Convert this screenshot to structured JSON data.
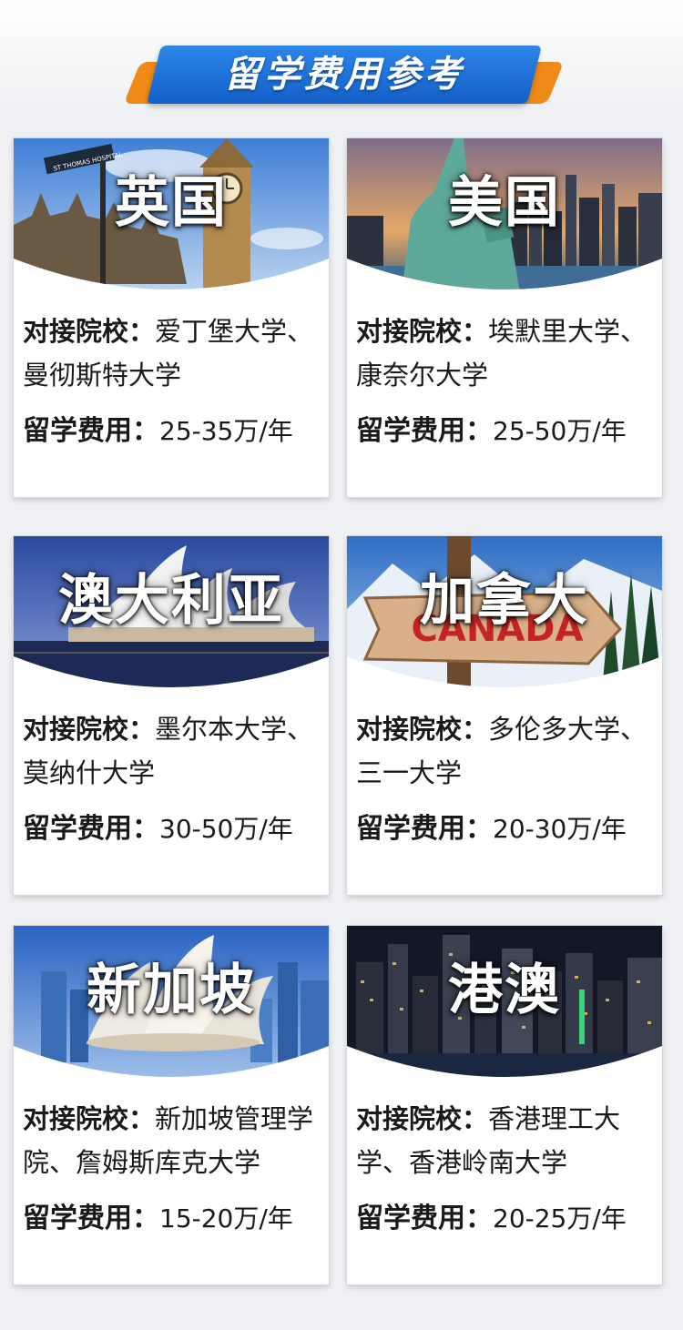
{
  "header": {
    "title": "留学费用参考"
  },
  "labels": {
    "schools": "对接院校：",
    "fee": "留学费用："
  },
  "cards": [
    {
      "country": "英国",
      "schools": "爱丁堡大学、曼彻斯特大学",
      "fee": "25-35万/年",
      "sign_text": "ST THOMAS HOSPITAL"
    },
    {
      "country": "美国",
      "schools": "埃默里大学、康奈尔大学",
      "fee": "25-50万/年"
    },
    {
      "country": "澳大利亚",
      "schools": "墨尔本大学、莫纳什大学",
      "fee": "30-50万/年"
    },
    {
      "country": "加拿大",
      "schools": "多伦多大学、三一大学",
      "fee": "20-30万/年",
      "sign_text": "CANADA"
    },
    {
      "country": "新加坡",
      "schools": "新加坡管理学院、詹姆斯库克大学",
      "fee": "15-20万/年"
    },
    {
      "country": "港澳",
      "schools": "香港理工大学、香港岭南大学",
      "fee": "20-25万/年"
    }
  ]
}
